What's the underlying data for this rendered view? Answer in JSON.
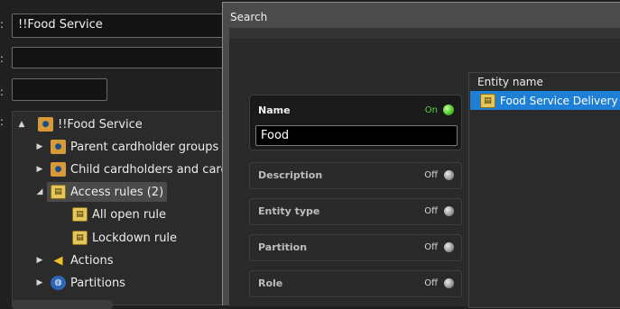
{
  "background": {
    "name_value": "!!Food Service",
    "tree": {
      "root": "!!Food Service",
      "items": [
        {
          "label": "Parent cardholder groups"
        },
        {
          "label": "Child cardholders and cardho"
        },
        {
          "label": "Access rules (2)"
        },
        {
          "label": "All open rule"
        },
        {
          "label": "Lockdown rule"
        },
        {
          "label": "Actions"
        },
        {
          "label": "Partitions"
        }
      ]
    }
  },
  "dialog": {
    "title": "Search",
    "filters": {
      "name": {
        "label": "Name",
        "state": "On",
        "value": "Food"
      },
      "description": {
        "label": "Description",
        "state": "Off"
      },
      "entity_type": {
        "label": "Entity type",
        "state": "Off"
      },
      "partition": {
        "label": "Partition",
        "state": "Off"
      },
      "role": {
        "label": "Role",
        "state": "Off"
      }
    },
    "results": {
      "header": "Entity name",
      "rows": [
        {
          "label": "Food Service Delivery",
          "icon": "access-rule-icon"
        }
      ]
    }
  },
  "colors": {
    "selection": "#1d7fd6",
    "on_state": "#5fd24a"
  }
}
